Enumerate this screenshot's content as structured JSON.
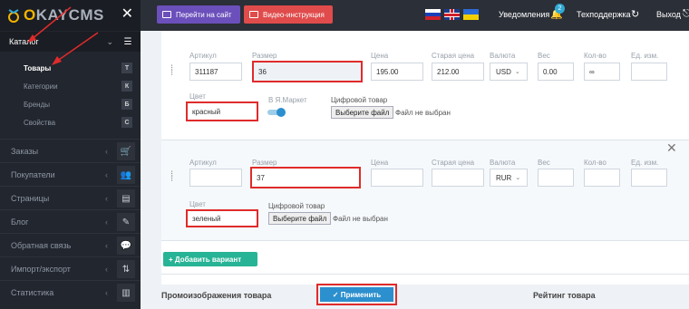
{
  "brand": {
    "logo_o": "O",
    "logo_rest": "KAYCMS"
  },
  "sidebar": {
    "catalog_label": "Каталог",
    "sub_items": [
      {
        "label": "Товары",
        "letter": "T"
      },
      {
        "label": "Категории",
        "letter": "К"
      },
      {
        "label": "Бренды",
        "letter": "Б"
      },
      {
        "label": "Свойства",
        "letter": "С"
      }
    ],
    "sections": [
      {
        "label": "Заказы"
      },
      {
        "label": "Покупатели"
      },
      {
        "label": "Страницы"
      },
      {
        "label": "Блог"
      },
      {
        "label": "Обратная связь"
      },
      {
        "label": "Импорт/экспорт"
      },
      {
        "label": "Статистика"
      }
    ]
  },
  "topbar": {
    "site_button": "Перейти на сайт",
    "video_button": "Видео-инструкция",
    "notifications": "Уведомления",
    "notif_count": "2",
    "support": "Техподдержка",
    "logout": "Выход"
  },
  "labels": {
    "sku": "Артикул",
    "size": "Размер",
    "price": "Цена",
    "old_price": "Старая цена",
    "currency": "Валюта",
    "weight": "Вес",
    "qty": "Кол-во",
    "unit": "Ед. изм.",
    "color": "Цвет",
    "yamarket": "В Я.Маркет",
    "digital": "Цифровой товар",
    "choose_file": "Выберите файл",
    "no_file": "Файл не выбран"
  },
  "variants": [
    {
      "sku": "311187",
      "size": "36",
      "price": "195.00",
      "old_price": "212.00",
      "currency": "USD",
      "weight": "0.00",
      "qty": "∞",
      "unit": "",
      "color": "красный"
    },
    {
      "sku": "",
      "size": "37",
      "price": "",
      "old_price": "",
      "currency": "RUR",
      "weight": "",
      "qty": "",
      "unit": "",
      "color": "зеленый"
    }
  ],
  "add_variant": "+ Добавить вариант",
  "footer": {
    "left": "Промоизображения товара",
    "right": "Рейтинг товара"
  },
  "apply": "✓  Применить",
  "colors": {
    "highlight": "#e02b2b",
    "accent": "#2c8fce",
    "add": "#27b395"
  }
}
